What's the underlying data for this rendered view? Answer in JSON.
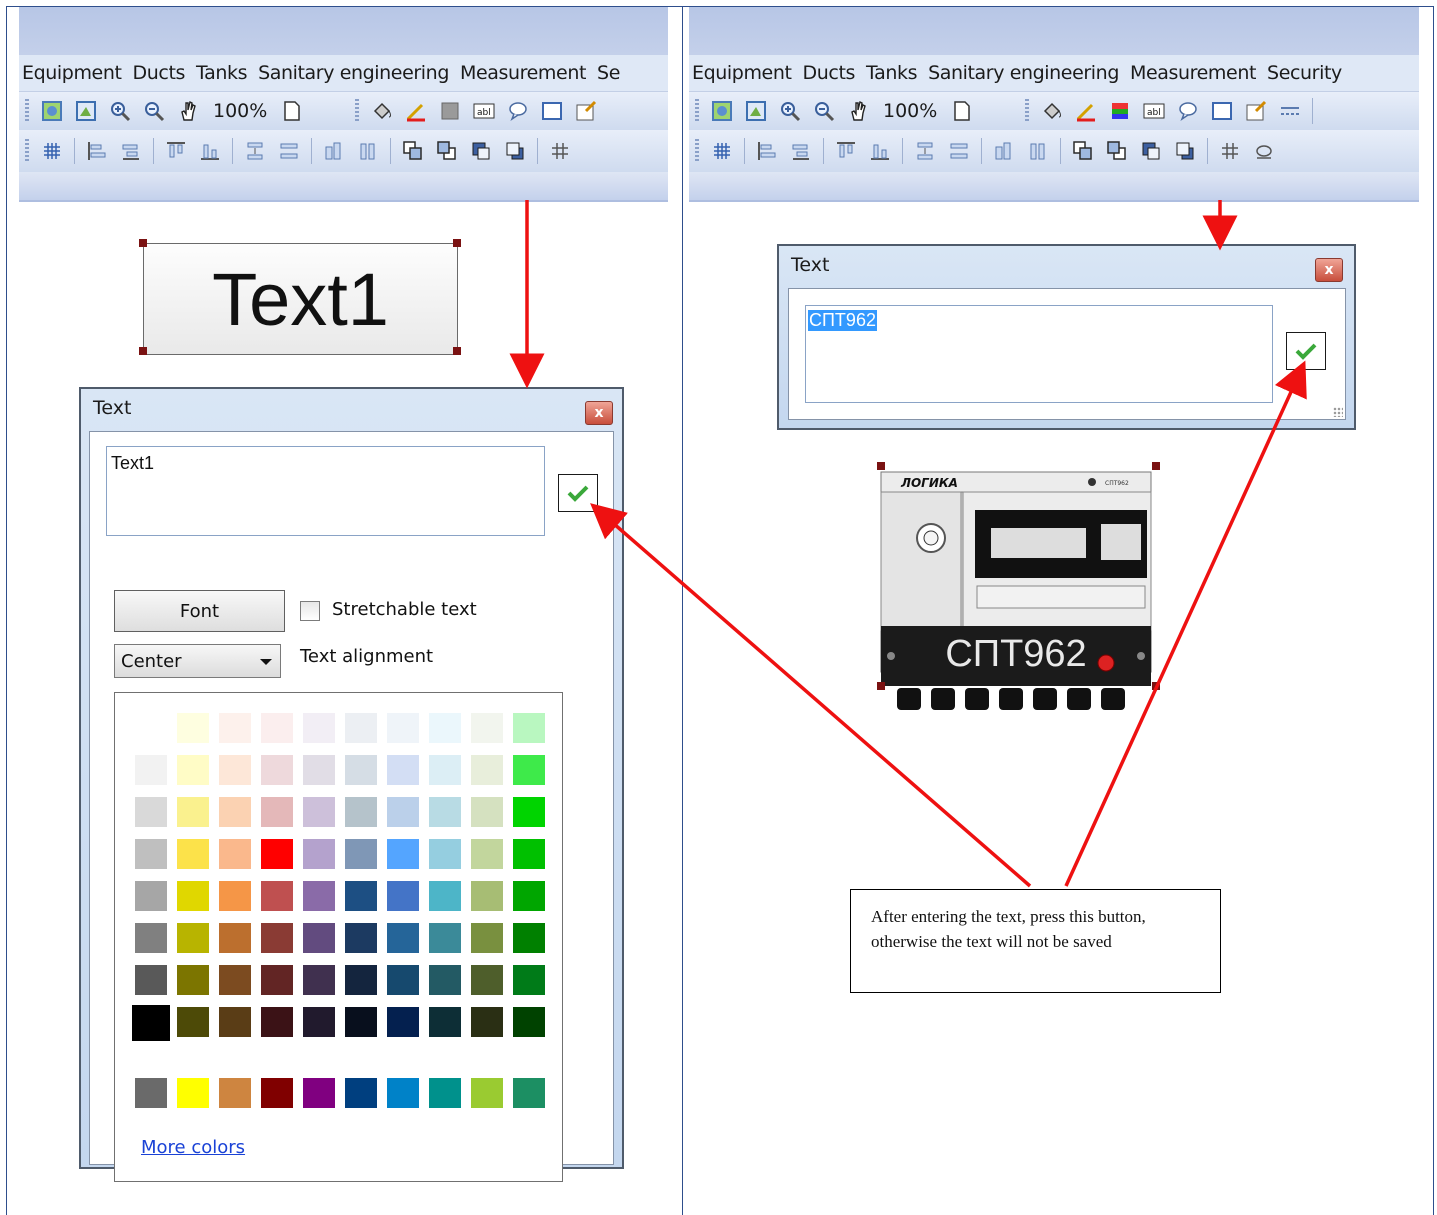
{
  "left_ribbon": {
    "menu": [
      "Equipment",
      "Ducts",
      "Tanks",
      "Sanitary engineering",
      "Measurement",
      "Se"
    ],
    "zoom": "100%"
  },
  "right_ribbon": {
    "menu": [
      "Equipment",
      "Ducts",
      "Tanks",
      "Sanitary engineering",
      "Measurement",
      "Security"
    ],
    "zoom": "100%"
  },
  "canvas_left": {
    "text_element_label": "Text1"
  },
  "dialog_left": {
    "title": "Text",
    "close_glyph": "x",
    "text_value": "Text1",
    "font_button": "Font",
    "stretchable_label": "Stretchable text",
    "alignment_value": "Center",
    "alignment_label": "Text alignment",
    "more_colors_link": "More colors",
    "palette_rows": [
      [
        "#ffffff",
        "#fefee0",
        "#fdf1ec",
        "#fbeeee",
        "#f2eef5",
        "#eceff3",
        "#eff4f9",
        "#ebf7fc",
        "#f2f5ee",
        "#b9f7c0"
      ],
      [
        "#f2f2f2",
        "#fffcc6",
        "#fde7d8",
        "#eed9dc",
        "#e1dde6",
        "#d5dde5",
        "#d3def4",
        "#dceef5",
        "#e8eedb",
        "#3eea4a"
      ],
      [
        "#d9d9d9",
        "#faf18e",
        "#fbd2b2",
        "#e4b8b9",
        "#cdc0da",
        "#b5c3cb",
        "#bbd0ea",
        "#b8dbe4",
        "#d5e1c0",
        "#00d400"
      ],
      [
        "#bfbfbf",
        "#fce24a",
        "#fab88c",
        "#ff0000",
        "#b4a2cd",
        "#7f97b6",
        "#54a5ff",
        "#95cee0",
        "#c2d69d",
        "#00c000"
      ],
      [
        "#a6a6a6",
        "#e0d700",
        "#f59647",
        "#bf5050",
        "#8a6ba8",
        "#1d4f83",
        "#4474c7",
        "#4db5c8",
        "#a7bd74",
        "#00a600"
      ],
      [
        "#808080",
        "#b8b400",
        "#bc6f2e",
        "#8a3b34",
        "#624b7f",
        "#1c3a61",
        "#256599",
        "#3b8a99",
        "#79903f",
        "#008000"
      ],
      [
        "#595959",
        "#7c7500",
        "#7c4b20",
        "#622524",
        "#40304f",
        "#14253e",
        "#16496e",
        "#235a64",
        "#4e5e2b",
        "#007b18"
      ],
      [
        "#000000",
        "#4d4a07",
        "#5a3d16",
        "#3b1216",
        "#211a2d",
        "#080f1d",
        "#04204f",
        "#0d2e36",
        "#2a2f14",
        "#004200"
      ]
    ],
    "palette_standard": [
      "#6a6a6a",
      "#ffff00",
      "#ce8540",
      "#800000",
      "#800080",
      "#003f7f",
      "#0082c8",
      "#00918c",
      "#9acb31",
      "#1c8f63"
    ]
  },
  "dialog_right": {
    "title": "Text",
    "close_glyph": "x",
    "text_value": "СПТ962"
  },
  "device": {
    "brand": "ЛОГИКА",
    "model_small": "СПТ962",
    "label": "СПТ962"
  },
  "callout": {
    "text": "After entering the text, press this button, otherwise the text will not be saved"
  }
}
